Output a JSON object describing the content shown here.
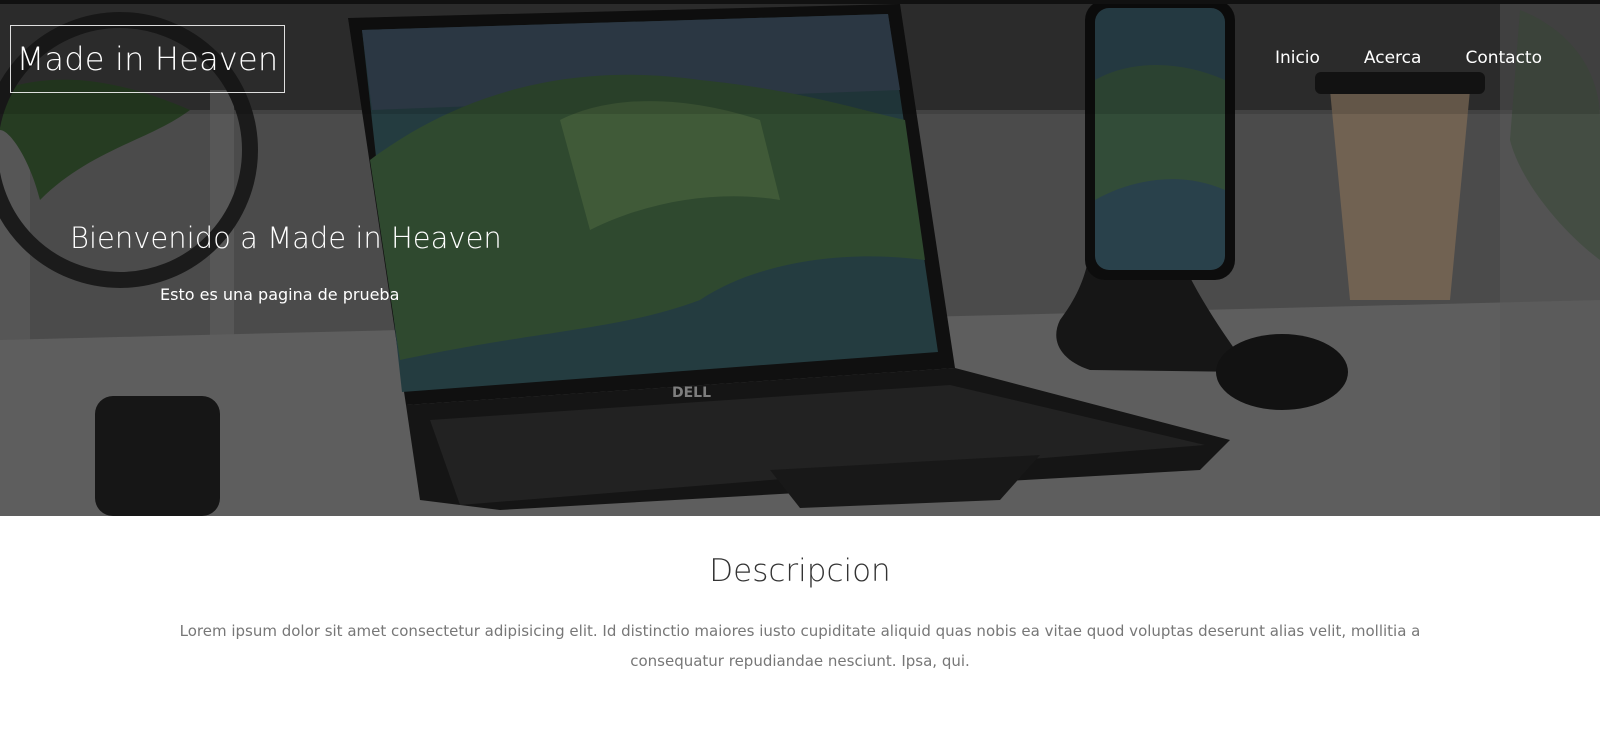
{
  "header": {
    "brand": "Made in Heaven",
    "nav": [
      "Inicio",
      "Acerca",
      "Contacto"
    ]
  },
  "hero": {
    "title": "Bienvenido a Made in Heaven",
    "subtitle": "Esto es una pagina de prueba",
    "laptop_logo": "DELL"
  },
  "about": {
    "heading": "Descripcion",
    "text": "Lorem ipsum dolor sit amet consectetur adipisicing elit. Id distinctio maiores iusto cupiditate aliquid quas nobis ea vitae quod voluptas deserunt alias velit, mollitia a consequatur repudiandae nesciunt. Ipsa, qui."
  },
  "colors": {
    "hero_overlay": "#1f1f1f",
    "accent_text": "#ffffff",
    "body_text": "#777777"
  }
}
